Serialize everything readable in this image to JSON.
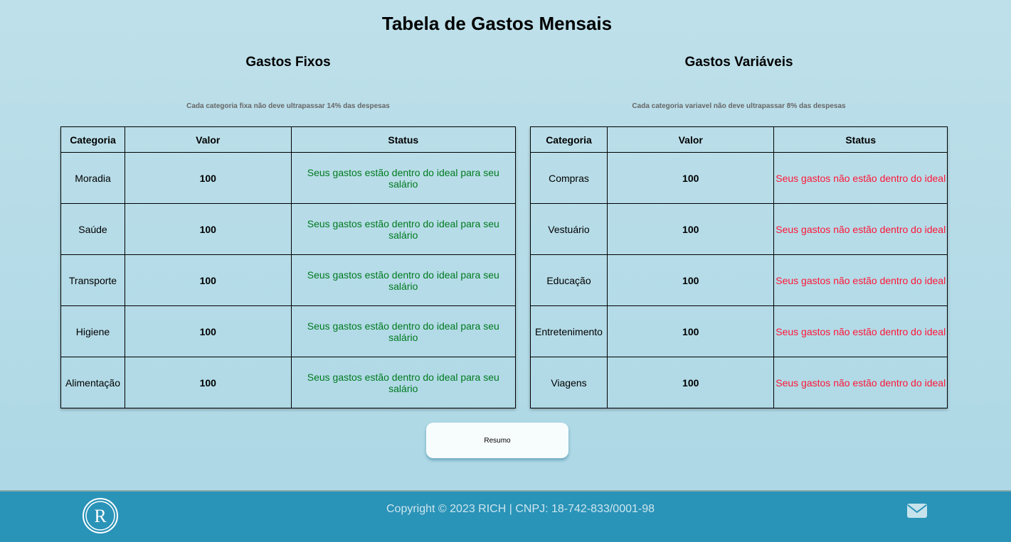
{
  "title": "Tabela de Gastos Mensais",
  "fixos": {
    "title": "Gastos Fixos",
    "note": "Cada categoria fixa não deve ultrapassar 14% das despesas",
    "headers": [
      "Categoria",
      "Valor",
      "Status"
    ],
    "rows": [
      {
        "categoria": "Moradia",
        "valor": "100",
        "status": "Seus gastos estão dentro do ideal para seu salário"
      },
      {
        "categoria": "Saúde",
        "valor": "100",
        "status": "Seus gastos estão dentro do ideal para seu salário"
      },
      {
        "categoria": "Transporte",
        "valor": "100",
        "status": "Seus gastos estão dentro do ideal para seu salário"
      },
      {
        "categoria": "Higiene",
        "valor": "100",
        "status": "Seus gastos estão dentro do ideal para seu salário"
      },
      {
        "categoria": "Alimentação",
        "valor": "100",
        "status": "Seus gastos estão dentro do ideal para seu salário"
      }
    ]
  },
  "variaveis": {
    "title": "Gastos Variáveis",
    "note": "Cada categoria variavel não deve ultrapassar 8% das despesas",
    "headers": [
      "Categoria",
      "Valor",
      "Status"
    ],
    "rows": [
      {
        "categoria": "Compras",
        "valor": "100",
        "status": "Seus gastos não estão dentro do ideal"
      },
      {
        "categoria": "Vestuário",
        "valor": "100",
        "status": "Seus gastos não estão dentro do ideal"
      },
      {
        "categoria": "Educação",
        "valor": "100",
        "status": "Seus gastos não estão dentro do ideal"
      },
      {
        "categoria": "Entretenimento",
        "valor": "100",
        "status": "Seus gastos não estão dentro do ideal"
      },
      {
        "categoria": "Viagens",
        "valor": "100",
        "status": "Seus gastos não estão dentro do ideal"
      }
    ]
  },
  "button": "Resumo",
  "footer": {
    "copyright": "Copyright © 2023 RICH | CNPJ: 18-742-833/0001-98",
    "logo_text": "R"
  },
  "colors": {
    "ok": "#007a1f",
    "bad": "#ff1537",
    "footer": "#2a93b8"
  }
}
